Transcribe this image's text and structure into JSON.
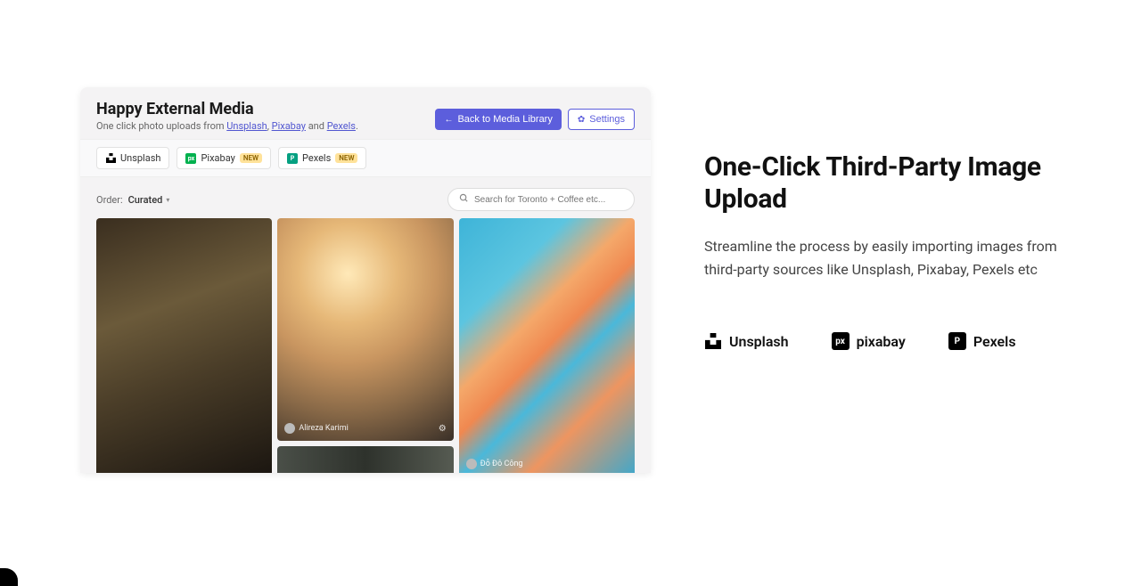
{
  "app": {
    "title": "Happy External Media",
    "subtitle_prefix": "One click photo uploads from ",
    "subtitle_links": [
      "Unsplash",
      "Pixabay",
      "Pexels"
    ],
    "subtitle_sep": ", ",
    "subtitle_and": " and ",
    "subtitle_suffix": "."
  },
  "header": {
    "back_label": "Back to Media Library",
    "settings_label": "Settings"
  },
  "tabs": [
    {
      "icon": "unsplash",
      "label": "Unsplash",
      "badge": null
    },
    {
      "icon": "pixabay",
      "label": "Pixabay",
      "badge": "NEW"
    },
    {
      "icon": "pexels",
      "label": "Pexels",
      "badge": "NEW"
    }
  ],
  "toolbar": {
    "order_label": "Order:",
    "order_value": "Curated",
    "search_placeholder": "Search for Toronto + Coffee etc..."
  },
  "gallery": {
    "attribution": "Alireza Karimi",
    "attribution2": "Đỗ Đô Công"
  },
  "feature": {
    "title": "One-Click Third-Party Image Upload",
    "description": "Streamline the process by easily importing images from third-party sources like Unsplash, Pixabay, Pexels etc"
  },
  "brands": [
    {
      "name": "Unsplash",
      "icon": "unsplash"
    },
    {
      "name": "pixabay",
      "icon": "pixabay"
    },
    {
      "name": "Pexels",
      "icon": "pexels"
    }
  ]
}
